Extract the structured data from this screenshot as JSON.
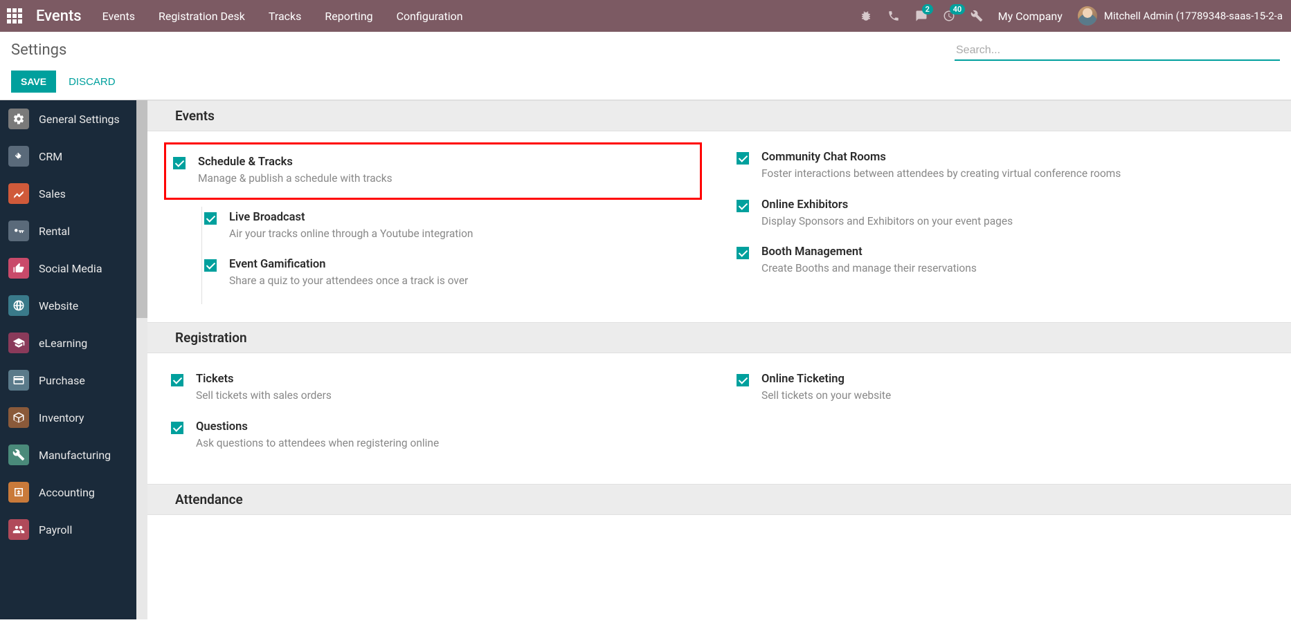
{
  "navbar": {
    "brand": "Events",
    "menu": [
      "Events",
      "Registration Desk",
      "Tracks",
      "Reporting",
      "Configuration"
    ],
    "messages_badge": "2",
    "activities_badge": "40",
    "company": "My Company",
    "user": "Mitchell Admin (17789348-saas-15-2-a"
  },
  "control": {
    "title": "Settings",
    "save": "SAVE",
    "discard": "DISCARD",
    "search_placeholder": "Search..."
  },
  "sidebar": {
    "items": [
      {
        "label": "General Settings",
        "color": "#7a7a7a"
      },
      {
        "label": "CRM",
        "color": "#5a6a7a"
      },
      {
        "label": "Sales",
        "color": "#d05a3a"
      },
      {
        "label": "Rental",
        "color": "#5a6a7a"
      },
      {
        "label": "Social Media",
        "color": "#c94a6a"
      },
      {
        "label": "Website",
        "color": "#3a7a8a"
      },
      {
        "label": "eLearning",
        "color": "#8a3a5a"
      },
      {
        "label": "Purchase",
        "color": "#5a7a8a"
      },
      {
        "label": "Inventory",
        "color": "#8a5a3a"
      },
      {
        "label": "Manufacturing",
        "color": "#4a8a7a"
      },
      {
        "label": "Accounting",
        "color": "#c97a3a"
      },
      {
        "label": "Payroll",
        "color": "#b04a5a"
      }
    ]
  },
  "sections": {
    "events": {
      "title": "Events",
      "left": [
        {
          "title": "Schedule & Tracks",
          "desc": "Manage & publish a schedule with tracks",
          "highlight": true,
          "checked": true
        },
        {
          "title": "Live Broadcast",
          "desc": "Air your tracks online through a Youtube integration",
          "indent": true,
          "checked": true
        },
        {
          "title": "Event Gamification",
          "desc": "Share a quiz to your attendees once a track is over",
          "indent": true,
          "checked": true
        }
      ],
      "right": [
        {
          "title": "Community Chat Rooms",
          "desc": "Foster interactions between attendees by creating virtual conference rooms",
          "checked": true
        },
        {
          "title": "Online Exhibitors",
          "desc": "Display Sponsors and Exhibitors on your event pages",
          "checked": true
        },
        {
          "title": "Booth Management",
          "desc": "Create Booths and manage their reservations",
          "checked": true
        }
      ]
    },
    "registration": {
      "title": "Registration",
      "left": [
        {
          "title": "Tickets",
          "desc": "Sell tickets with sales orders",
          "checked": true
        },
        {
          "title": "Questions",
          "desc": "Ask questions to attendees when registering online",
          "checked": true
        }
      ],
      "right": [
        {
          "title": "Online Ticketing",
          "desc": "Sell tickets on your website",
          "checked": true
        }
      ]
    },
    "attendance": {
      "title": "Attendance"
    }
  }
}
